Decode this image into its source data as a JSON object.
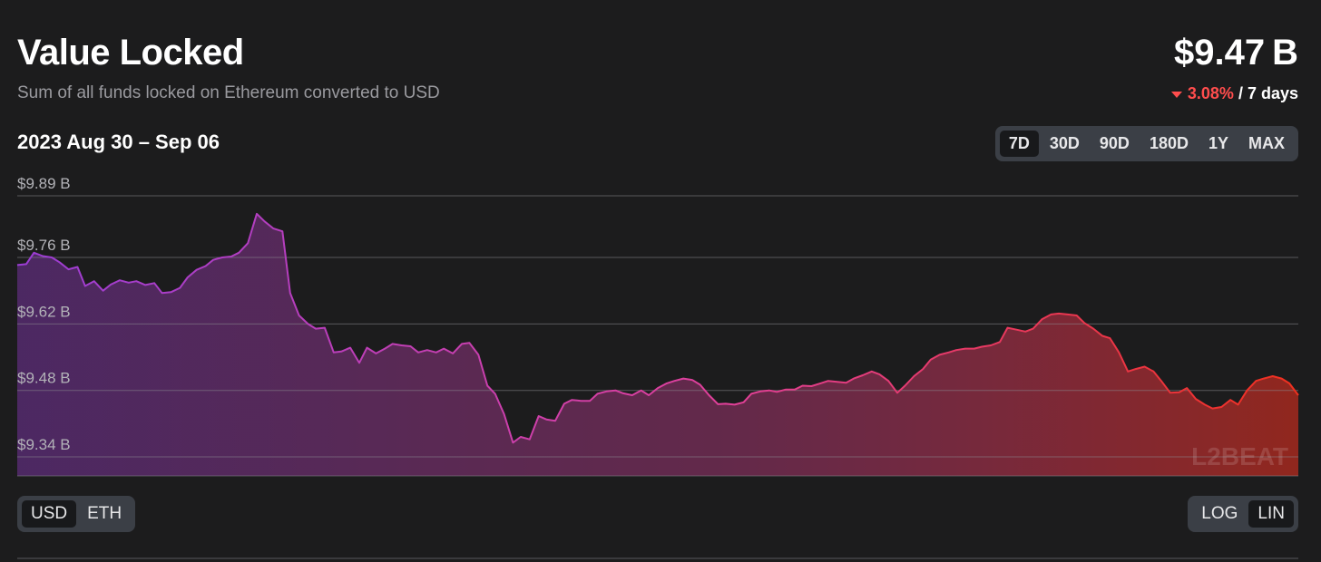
{
  "header": {
    "title": "Value Locked",
    "subtitle": "Sum of all funds locked on Ethereum converted to USD",
    "value": "$9.47 B",
    "change_pct": "3.08%",
    "change_period": "/ 7 days"
  },
  "date_range": "2023 Aug 30 – Sep 06",
  "time_options": [
    {
      "label": "7D",
      "active": true
    },
    {
      "label": "30D",
      "active": false
    },
    {
      "label": "90D",
      "active": false
    },
    {
      "label": "180D",
      "active": false
    },
    {
      "label": "1Y",
      "active": false
    },
    {
      "label": "MAX",
      "active": false
    }
  ],
  "unit_options": [
    {
      "label": "USD",
      "active": true
    },
    {
      "label": "ETH",
      "active": false
    }
  ],
  "scale_options": [
    {
      "label": "LOG",
      "active": false
    },
    {
      "label": "LIN",
      "active": true
    }
  ],
  "watermark": "L2BEAT",
  "colors": {
    "gradient_start": "#9b3dd4",
    "gradient_mid": "#e0409a",
    "gradient_end": "#f0301e",
    "down": "#ff4d4d"
  },
  "chart_data": {
    "type": "area",
    "ylim": [
      9.3,
      9.93
    ],
    "y_ticks": [
      {
        "value": 9.89,
        "label": "$9.89 B"
      },
      {
        "value": 9.76,
        "label": "$9.76 B"
      },
      {
        "value": 9.62,
        "label": "$9.62 B"
      },
      {
        "value": 9.48,
        "label": "$9.48 B"
      },
      {
        "value": 9.34,
        "label": "$9.34 B"
      }
    ],
    "x_range": [
      0,
      1
    ],
    "series": [
      {
        "values": [
          [
            0.0,
            9.744
          ],
          [
            0.007,
            9.746
          ],
          [
            0.013,
            9.77
          ],
          [
            0.02,
            9.763
          ],
          [
            0.027,
            9.76
          ],
          [
            0.033,
            9.75
          ],
          [
            0.04,
            9.735
          ],
          [
            0.047,
            9.74
          ],
          [
            0.053,
            9.7
          ],
          [
            0.06,
            9.71
          ],
          [
            0.067,
            9.69
          ],
          [
            0.073,
            9.703
          ],
          [
            0.08,
            9.712
          ],
          [
            0.087,
            9.707
          ],
          [
            0.093,
            9.71
          ],
          [
            0.1,
            9.702
          ],
          [
            0.107,
            9.706
          ],
          [
            0.113,
            9.685
          ],
          [
            0.12,
            9.687
          ],
          [
            0.127,
            9.696
          ],
          [
            0.133,
            9.718
          ],
          [
            0.14,
            9.734
          ],
          [
            0.147,
            9.742
          ],
          [
            0.153,
            9.755
          ],
          [
            0.16,
            9.76
          ],
          [
            0.167,
            9.762
          ],
          [
            0.173,
            9.77
          ],
          [
            0.18,
            9.79
          ],
          [
            0.187,
            9.852
          ],
          [
            0.193,
            9.836
          ],
          [
            0.2,
            9.821
          ],
          [
            0.207,
            9.815
          ],
          [
            0.213,
            9.685
          ],
          [
            0.22,
            9.638
          ],
          [
            0.227,
            9.62
          ],
          [
            0.233,
            9.61
          ],
          [
            0.24,
            9.612
          ],
          [
            0.247,
            9.56
          ],
          [
            0.253,
            9.562
          ],
          [
            0.26,
            9.57
          ],
          [
            0.267,
            9.538
          ],
          [
            0.273,
            9.57
          ],
          [
            0.28,
            9.558
          ],
          [
            0.287,
            9.568
          ],
          [
            0.293,
            9.578
          ],
          [
            0.3,
            9.575
          ],
          [
            0.307,
            9.573
          ],
          [
            0.313,
            9.56
          ],
          [
            0.32,
            9.565
          ],
          [
            0.327,
            9.56
          ],
          [
            0.333,
            9.568
          ],
          [
            0.34,
            9.558
          ],
          [
            0.347,
            9.578
          ],
          [
            0.353,
            9.58
          ],
          [
            0.36,
            9.555
          ],
          [
            0.367,
            9.49
          ],
          [
            0.373,
            9.473
          ],
          [
            0.38,
            9.43
          ],
          [
            0.387,
            9.37
          ],
          [
            0.393,
            9.382
          ],
          [
            0.4,
            9.377
          ],
          [
            0.407,
            9.426
          ],
          [
            0.413,
            9.419
          ],
          [
            0.42,
            9.416
          ],
          [
            0.427,
            9.452
          ],
          [
            0.433,
            9.46
          ],
          [
            0.44,
            9.458
          ],
          [
            0.447,
            9.458
          ],
          [
            0.453,
            9.473
          ],
          [
            0.46,
            9.478
          ],
          [
            0.467,
            9.48
          ],
          [
            0.473,
            9.474
          ],
          [
            0.48,
            9.47
          ],
          [
            0.487,
            9.48
          ],
          [
            0.493,
            9.47
          ],
          [
            0.5,
            9.485
          ],
          [
            0.507,
            9.495
          ],
          [
            0.513,
            9.5
          ],
          [
            0.52,
            9.505
          ],
          [
            0.527,
            9.502
          ],
          [
            0.533,
            9.492
          ],
          [
            0.54,
            9.47
          ],
          [
            0.547,
            9.451
          ],
          [
            0.553,
            9.452
          ],
          [
            0.56,
            9.45
          ],
          [
            0.567,
            9.455
          ],
          [
            0.573,
            9.473
          ],
          [
            0.58,
            9.478
          ],
          [
            0.587,
            9.48
          ],
          [
            0.593,
            9.477
          ],
          [
            0.6,
            9.482
          ],
          [
            0.607,
            9.482
          ],
          [
            0.613,
            9.49
          ],
          [
            0.62,
            9.489
          ],
          [
            0.627,
            9.495
          ],
          [
            0.633,
            9.5
          ],
          [
            0.64,
            9.498
          ],
          [
            0.647,
            9.496
          ],
          [
            0.653,
            9.505
          ],
          [
            0.66,
            9.512
          ],
          [
            0.667,
            9.52
          ],
          [
            0.673,
            9.514
          ],
          [
            0.68,
            9.5
          ],
          [
            0.687,
            9.475
          ],
          [
            0.693,
            9.49
          ],
          [
            0.7,
            9.51
          ],
          [
            0.707,
            9.525
          ],
          [
            0.713,
            9.545
          ],
          [
            0.72,
            9.555
          ],
          [
            0.727,
            9.56
          ],
          [
            0.733,
            9.565
          ],
          [
            0.74,
            9.568
          ],
          [
            0.747,
            9.568
          ],
          [
            0.753,
            9.572
          ],
          [
            0.76,
            9.575
          ],
          [
            0.767,
            9.582
          ],
          [
            0.773,
            9.612
          ],
          [
            0.78,
            9.608
          ],
          [
            0.787,
            9.604
          ],
          [
            0.793,
            9.61
          ],
          [
            0.8,
            9.63
          ],
          [
            0.807,
            9.64
          ],
          [
            0.813,
            9.642
          ],
          [
            0.82,
            9.64
          ],
          [
            0.827,
            9.638
          ],
          [
            0.833,
            9.622
          ],
          [
            0.84,
            9.61
          ],
          [
            0.847,
            9.595
          ],
          [
            0.853,
            9.59
          ],
          [
            0.86,
            9.56
          ],
          [
            0.867,
            9.52
          ],
          [
            0.873,
            9.525
          ],
          [
            0.88,
            9.53
          ],
          [
            0.887,
            9.52
          ],
          [
            0.893,
            9.5
          ],
          [
            0.9,
            9.475
          ],
          [
            0.907,
            9.476
          ],
          [
            0.913,
            9.485
          ],
          [
            0.92,
            9.462
          ],
          [
            0.927,
            9.45
          ],
          [
            0.933,
            9.442
          ],
          [
            0.94,
            9.445
          ],
          [
            0.947,
            9.46
          ],
          [
            0.953,
            9.45
          ],
          [
            0.96,
            9.48
          ],
          [
            0.967,
            9.5
          ],
          [
            0.973,
            9.505
          ],
          [
            0.98,
            9.51
          ],
          [
            0.987,
            9.505
          ],
          [
            0.993,
            9.495
          ],
          [
            1.0,
            9.47
          ]
        ]
      }
    ]
  }
}
